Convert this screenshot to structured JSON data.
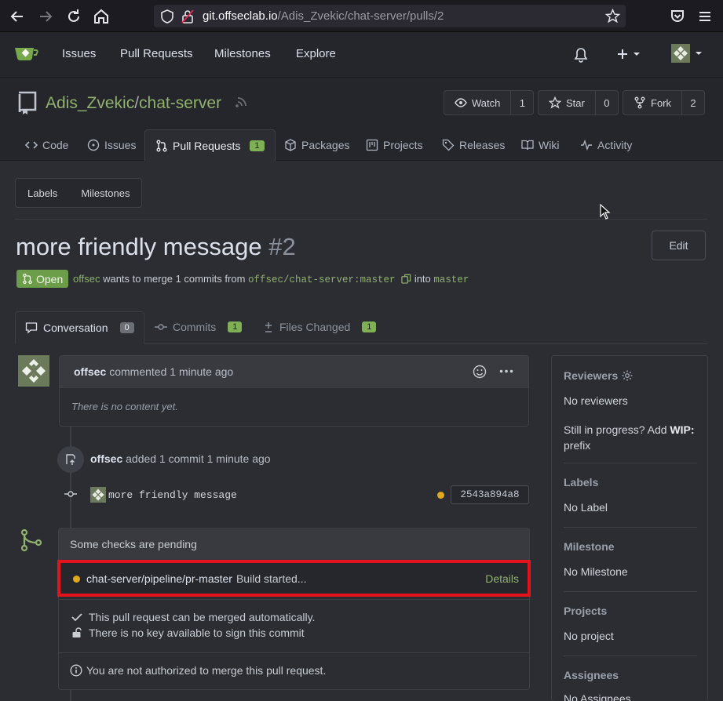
{
  "browser": {
    "url_domain": "git.offseclab.io",
    "url_path": "/Adis_Zvekic/chat-server/pulls/2"
  },
  "nav": {
    "items": [
      "Issues",
      "Pull Requests",
      "Milestones",
      "Explore"
    ]
  },
  "repo": {
    "owner": "Adis_Zvekic",
    "separator": "/",
    "name": "chat-server",
    "watch_label": "Watch",
    "watch_count": "1",
    "star_label": "Star",
    "star_count": "0",
    "fork_label": "Fork",
    "fork_count": "2",
    "tabs": {
      "code": "Code",
      "issues": "Issues",
      "pulls": "Pull Requests",
      "pulls_count": "1",
      "packages": "Packages",
      "projects": "Projects",
      "releases": "Releases",
      "wiki": "Wiki",
      "activity": "Activity"
    }
  },
  "filters": {
    "labels": "Labels",
    "milestones": "Milestones"
  },
  "pr": {
    "title": "more friendly message",
    "number": "#2",
    "edit_label": "Edit",
    "state": "Open",
    "author": "offsec",
    "merge_text_1": "wants to merge 1 commits from",
    "source_branch": "offsec/chat-server:master",
    "merge_text_2": "into",
    "target_branch": "master"
  },
  "conv_tabs": {
    "conversation": "Conversation",
    "conversation_count": "0",
    "commits": "Commits",
    "commits_count": "1",
    "files": "Files Changed",
    "files_count": "1"
  },
  "comment": {
    "author": "offsec",
    "meta": "commented 1 minute ago",
    "body": "There is no content yet."
  },
  "event": {
    "author": "offsec",
    "text": "added 1 commit 1 minute ago",
    "commit_message": "more friendly message",
    "commit_sha": "2543a894a8"
  },
  "merge": {
    "checks_title": "Some checks are pending",
    "check_name": "chat-server/pipeline/pr-master",
    "check_status": "Build started...",
    "check_details": "Details",
    "auto_merge": "This pull request can be merged automatically.",
    "no_key": "There is no key available to sign this commit",
    "not_authorized": "You are not authorized to merge this pull request."
  },
  "sidebar": {
    "reviewers_title": "Reviewers",
    "no_reviewers": "No reviewers",
    "wip_text": "Still in progress? Add",
    "wip_keyword": "WIP:",
    "wip_suffix": "prefix",
    "labels_title": "Labels",
    "no_label": "No Label",
    "milestone_title": "Milestone",
    "no_milestone": "No Milestone",
    "projects_title": "Projects",
    "no_project": "No project",
    "assignees_title": "Assignees",
    "no_assignees": "No Assignees"
  },
  "colors": {
    "accent": "#8fb26c",
    "open": "#6c9d48",
    "pending": "#e0a91b",
    "highlight": "#e3131b"
  }
}
